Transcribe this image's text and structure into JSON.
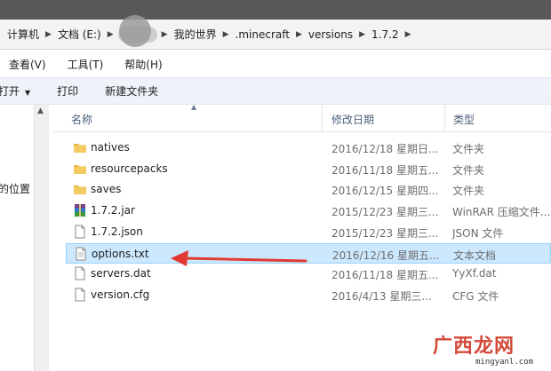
{
  "address": {
    "crumbs": [
      "计算机",
      "文档 (E:)",
      "",
      "我的世界",
      ".minecraft",
      "versions",
      "1.7.2"
    ]
  },
  "menu": [
    "查看(V)",
    "工具(T)",
    "帮助(H)"
  ],
  "toolbar": {
    "open_label": "打开",
    "print_label": "打印",
    "new_folder_label": "新建文件夹"
  },
  "nav": {
    "location_label": "的位置"
  },
  "columns": {
    "name": "名称",
    "modified": "修改日期",
    "type": "类型"
  },
  "files": [
    {
      "name": "natives",
      "modified": "2016/12/18 星期日...",
      "type": "文件夹",
      "icon": "folder-icon"
    },
    {
      "name": "resourcepacks",
      "modified": "2016/11/18 星期五...",
      "type": "文件夹",
      "icon": "folder-icon"
    },
    {
      "name": "saves",
      "modified": "2016/12/15 星期四...",
      "type": "文件夹",
      "icon": "folder-icon"
    },
    {
      "name": "1.7.2.jar",
      "modified": "2015/12/23 星期三...",
      "type": "WinRAR 压缩文件...",
      "icon": "winrar-archive-icon"
    },
    {
      "name": "1.7.2.json",
      "modified": "2015/12/23 星期三...",
      "type": "JSON 文件",
      "icon": "file-icon"
    },
    {
      "name": "options.txt",
      "modified": "2016/12/16 星期五...",
      "type": "文本文档",
      "icon": "text-file-icon"
    },
    {
      "name": "servers.dat",
      "modified": "2016/11/18 星期五...",
      "type": "YyXf.dat",
      "icon": "file-icon"
    },
    {
      "name": "version.cfg",
      "modified": "2016/4/13 星期三...",
      "type": "CFG 文件",
      "icon": "file-icon"
    }
  ],
  "selected_file": "options.txt",
  "annotation_color": "#e03a32",
  "selection_color": "#cce8ff",
  "watermark": {
    "text": "广西龙网",
    "url": "mingyanl.com"
  }
}
